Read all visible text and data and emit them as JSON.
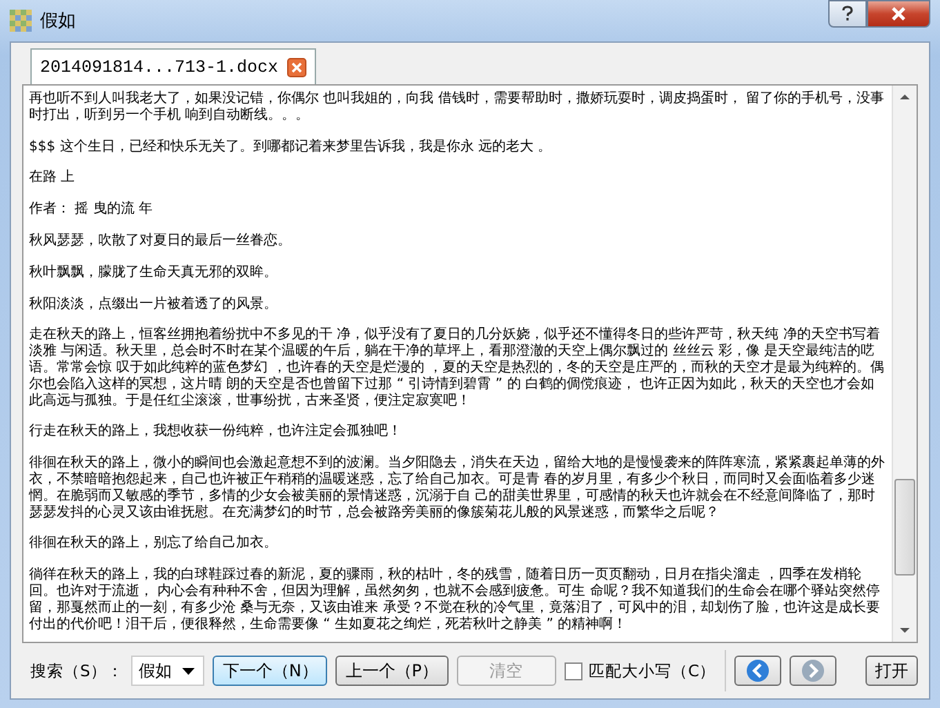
{
  "window": {
    "title": "假如"
  },
  "tabs": [
    {
      "label": "2014091814...713-1.docx",
      "selected": true
    }
  ],
  "document": {
    "paragraphs": [
      "再也听不到人叫我老大了，如果没记错，你偶尔 也叫我姐的，向我 借钱时，需要帮助时，撒娇玩耍时，调皮捣蛋时， 留了你的手机号，没事时打出，听到另一个手机 响到自动断线。。。",
      "$$$ 这个生日，已经和快乐无关了。到哪都记着来梦里告诉我，我是你永 远的老大 。",
      "在路 上",
      "作者： 摇 曳的流 年",
      "秋风瑟瑟，吹散了对夏日的最后一丝眷恋。",
      "秋叶飘飘，朦胧了生命天真无邪的双眸。",
      "秋阳淡淡，点缀出一片被着透了的风景。",
      "走在秋天的路上，恒客丝拥抱着纷扰中不多见的干 净，似乎没有了夏日的几分妖娆，似乎还不懂得冬日的些许严苛，秋天纯 净的天空书写着淡雅 与闲适。秋天里，总会时不时在某个温暖的午后，躺在干净的草坪上，看那澄澈的天空上偶尔飘过的 丝丝云 彩，像 是天空最纯洁的呓语。常常会惊 叹于如此纯粹的蓝色梦幻 ，也许春的天空是烂漫的 ，夏的天空是热烈的，冬的天空是庄严的，而秋的天空才是最为纯粹的。偶尔也会陷入这样的冥想，这片晴 朗的天空是否也曾留下过那 “ 引诗情到碧霄 ” 的 白鹤的倜傥痕迹， 也许正因为如此，秋天的天空也才会如此高远与孤独。于是任红尘滚滚，世事纷扰，古来圣贤，便注定寂寞吧！",
      "行走在秋天的路上，我想收获一份纯粹，也许注定会孤独吧！",
      "徘徊在秋天的路上，微小的瞬间也会激起意想不到的波澜。当夕阳隐去，消失在天边，留给大地的是慢慢袭来的阵阵寒流，紧紧裹起单薄的外衣，不禁暗暗抱怨起来，自己也许被正午稍稍的温暖迷惑，忘了给自己加衣。可是青 春的岁月里，有多少个秋日，而同时又会面临着多少迷惘。在脆弱而又敏感的季节，多情的少女会被美丽的景情迷惑，沉溺于自 己的甜美世界里，可感情的秋天也许就会在不经意间降临了，那时瑟瑟发抖的心灵又该由谁抚慰。在充满梦幻的时节，总会被路旁美丽的像簇菊花儿般的风景迷惑，而繁华之后呢？",
      "徘徊在秋天的路上，别忘了给自己加衣。",
      "徜徉在秋天的路上，我的白球鞋踩过春的新泥，夏的骤雨，秋的枯叶，冬的残雪，随着日历一页页翻动，日月在指尖溜走 ，四季在发梢轮回。也许对于流逝， 内心会有种种不舍，但因为理解，虽然匆匆，也就不会感到疲惫。可生 命呢？我不知道我们的生命会在哪个驿站突然停留，那戛然而止的一刻，有多少沧 桑与无奈，又该由谁来 承受？不觉在秋的冷气里，竟落泪了，可风中的泪，却划伤了脸，也许这是成长要付出的代价吧！泪干后，便很释然，生命需要像 “ 生如夏花之绚烂，死若秋叶之静美 ” 的精神啊！"
    ]
  },
  "search": {
    "label": "搜索（S）：",
    "value": "假如"
  },
  "buttons": [
    {
      "label": "下一个（N）",
      "disabled": false,
      "focused": true
    },
    {
      "label": "上一个（P）",
      "disabled": false,
      "focused": false
    },
    {
      "label": "清空",
      "disabled": true,
      "focused": false
    }
  ],
  "match_case": {
    "label": "匹配大小写（C）",
    "checked": false
  },
  "open_button": {
    "label": "打开"
  }
}
